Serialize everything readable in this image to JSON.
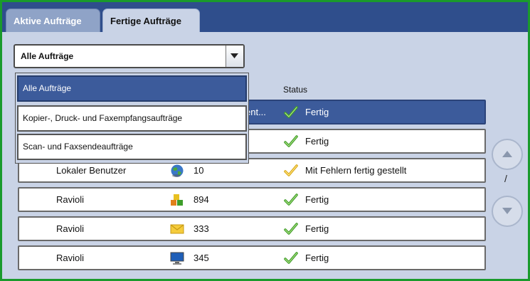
{
  "tabs": {
    "active_jobs": "Aktive Aufträge",
    "completed_jobs": "Fertige Aufträge"
  },
  "filter": {
    "value": "Alle Aufträge",
    "options": [
      "Alle Aufträge",
      "Kopier-, Druck- und Faxempfangsaufträge",
      "Scan- und Faxsendeaufträge"
    ]
  },
  "table": {
    "status_header": "Status",
    "rows": [
      {
        "user": "",
        "icon": "document-icon",
        "count": "",
        "name_truncated": "ent...",
        "status": "Fertig",
        "status_icon": "check-green-icon",
        "selected": true
      },
      {
        "user": "",
        "icon": "",
        "count": "",
        "name_truncated": "",
        "status": "Fertig",
        "status_icon": "check-green-icon",
        "selected": false
      },
      {
        "user": "Lokaler Benutzer",
        "icon": "globe-icon",
        "count": "10",
        "name_truncated": "",
        "status": "Mit Fehlern fertig gestellt",
        "status_icon": "check-yellow-icon",
        "selected": false
      },
      {
        "user": "Ravioli",
        "icon": "blocks-icon",
        "count": "894",
        "name_truncated": "",
        "status": "Fertig",
        "status_icon": "check-green-icon",
        "selected": false
      },
      {
        "user": "Ravioli",
        "icon": "envelope-icon",
        "count": "333",
        "name_truncated": "",
        "status": "Fertig",
        "status_icon": "check-green-icon",
        "selected": false
      },
      {
        "user": "Ravioli",
        "icon": "monitor-icon",
        "count": "345",
        "name_truncated": "",
        "status": "Fertig",
        "status_icon": "check-green-icon",
        "selected": false
      }
    ]
  },
  "pagination": {
    "indicator": "/"
  }
}
